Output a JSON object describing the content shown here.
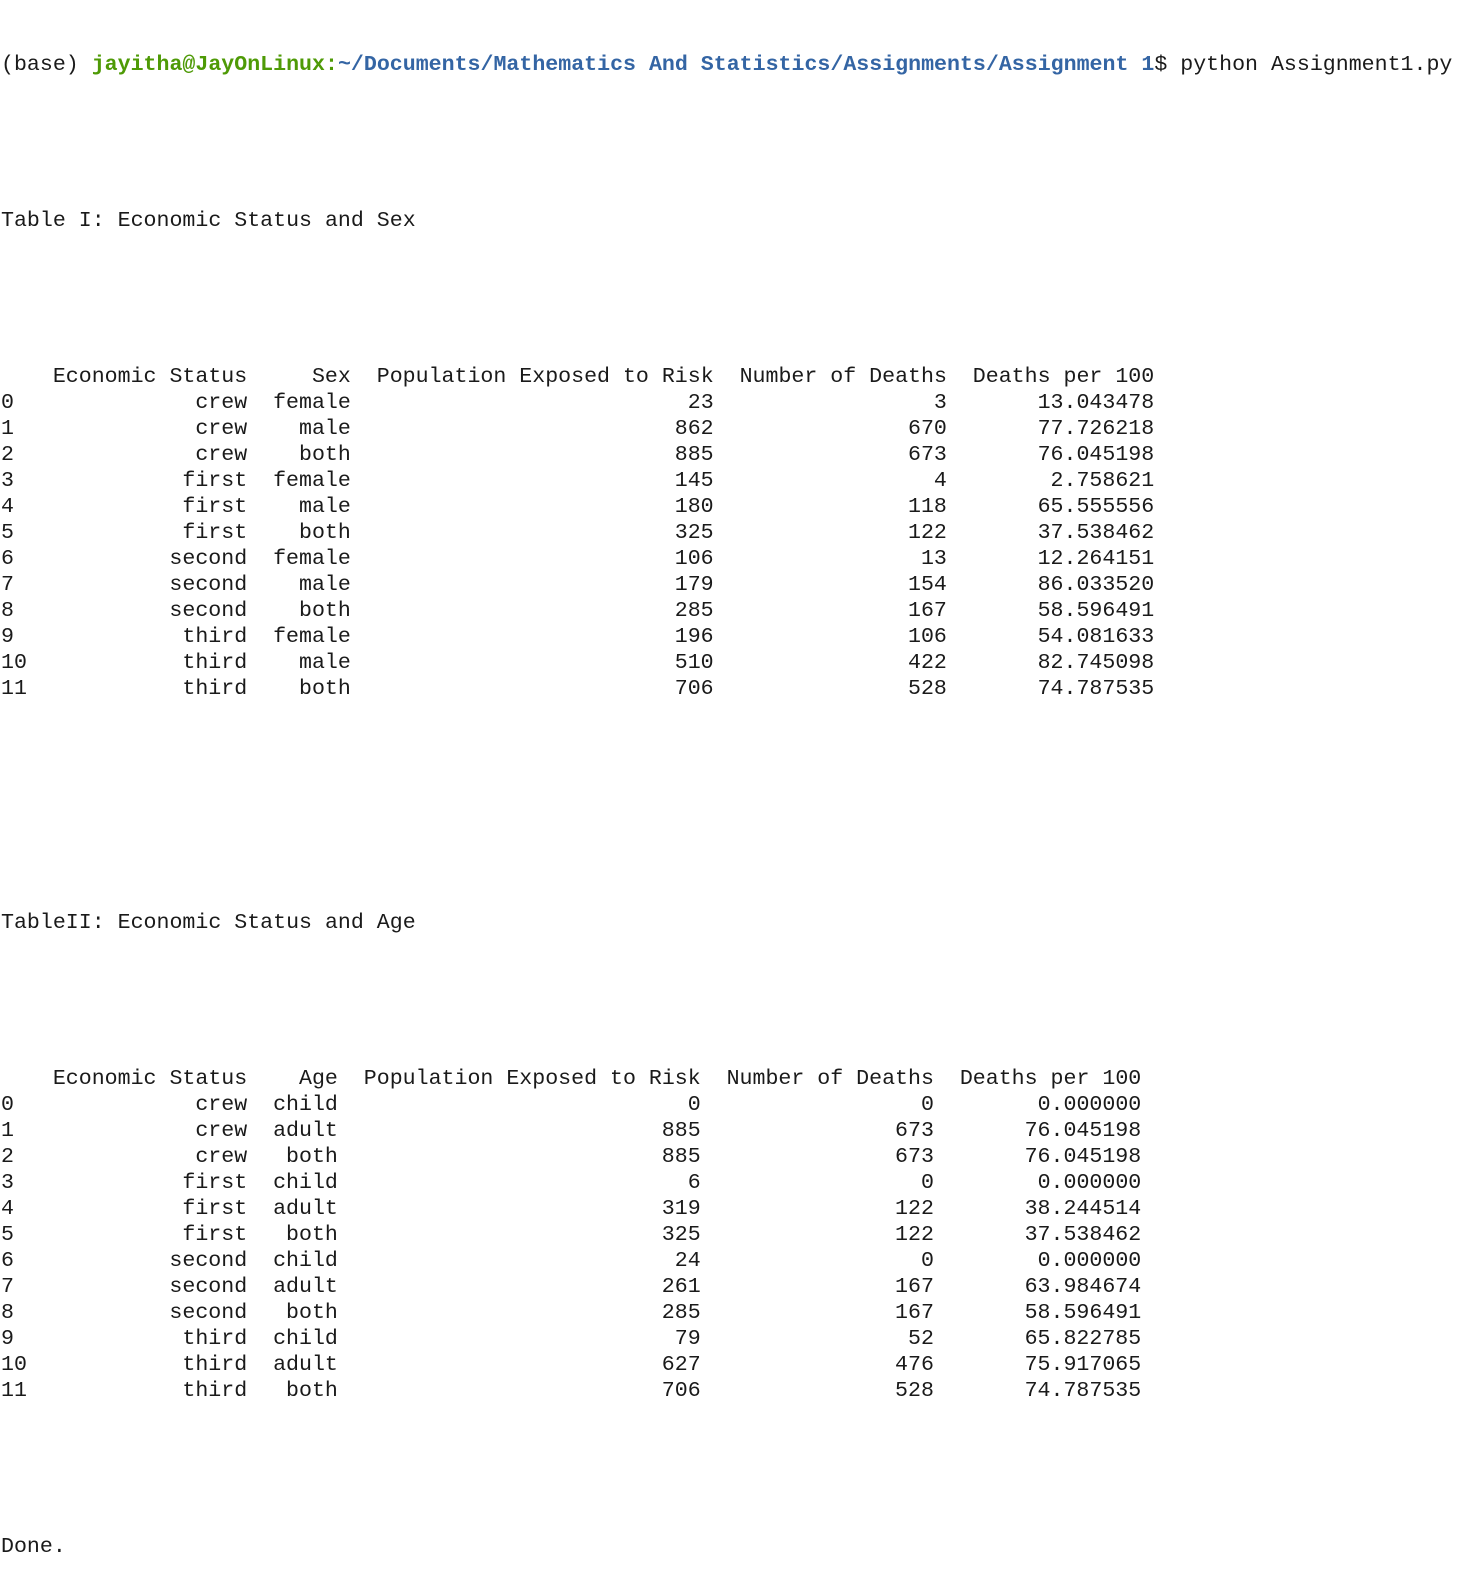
{
  "terminal": {
    "prompt": {
      "env": "(base) ",
      "user_host": "jayitha@JayOnLinux",
      "separator": ":",
      "cwd": "~/Documents/Mathematics And Statistics/Assignments/Assignment 1",
      "suffix": "$ ",
      "command": "python Assignment1.py"
    },
    "table1": {
      "title": "Table I: Economic Status and Sex",
      "columns": [
        "Economic Status",
        "Sex",
        "Population Exposed to Risk",
        "Number of Deaths",
        "Deaths per 100"
      ],
      "rows": [
        [
          "0",
          "crew",
          "female",
          "23",
          "3",
          "13.043478"
        ],
        [
          "1",
          "crew",
          "male",
          "862",
          "670",
          "77.726218"
        ],
        [
          "2",
          "crew",
          "both",
          "885",
          "673",
          "76.045198"
        ],
        [
          "3",
          "first",
          "female",
          "145",
          "4",
          "2.758621"
        ],
        [
          "4",
          "first",
          "male",
          "180",
          "118",
          "65.555556"
        ],
        [
          "5",
          "first",
          "both",
          "325",
          "122",
          "37.538462"
        ],
        [
          "6",
          "second",
          "female",
          "106",
          "13",
          "12.264151"
        ],
        [
          "7",
          "second",
          "male",
          "179",
          "154",
          "86.033520"
        ],
        [
          "8",
          "second",
          "both",
          "285",
          "167",
          "58.596491"
        ],
        [
          "9",
          "third",
          "female",
          "196",
          "106",
          "54.081633"
        ],
        [
          "10",
          "third",
          "male",
          "510",
          "422",
          "82.745098"
        ],
        [
          "11",
          "third",
          "both",
          "706",
          "528",
          "74.787535"
        ]
      ]
    },
    "table2": {
      "title": "TableII: Economic Status and Age",
      "columns": [
        "Economic Status",
        "Age",
        "Population Exposed to Risk",
        "Number of Deaths",
        "Deaths per 100"
      ],
      "rows": [
        [
          "0",
          "crew",
          "child",
          "0",
          "0",
          "0.000000"
        ],
        [
          "1",
          "crew",
          "adult",
          "885",
          "673",
          "76.045198"
        ],
        [
          "2",
          "crew",
          "both",
          "885",
          "673",
          "76.045198"
        ],
        [
          "3",
          "first",
          "child",
          "6",
          "0",
          "0.000000"
        ],
        [
          "4",
          "first",
          "adult",
          "319",
          "122",
          "38.244514"
        ],
        [
          "5",
          "first",
          "both",
          "325",
          "122",
          "37.538462"
        ],
        [
          "6",
          "second",
          "child",
          "24",
          "0",
          "0.000000"
        ],
        [
          "7",
          "second",
          "adult",
          "261",
          "167",
          "63.984674"
        ],
        [
          "8",
          "second",
          "both",
          "285",
          "167",
          "58.596491"
        ],
        [
          "9",
          "third",
          "child",
          "79",
          "52",
          "65.822785"
        ],
        [
          "10",
          "third",
          "adult",
          "627",
          "476",
          "75.917065"
        ],
        [
          "11",
          "third",
          "both",
          "706",
          "528",
          "74.787535"
        ]
      ]
    },
    "done": "Done.",
    "colors": {
      "user_host": "#4e9a06",
      "path": "#3465a4",
      "text": "#1a1a1a",
      "background": "#ffffff"
    }
  }
}
